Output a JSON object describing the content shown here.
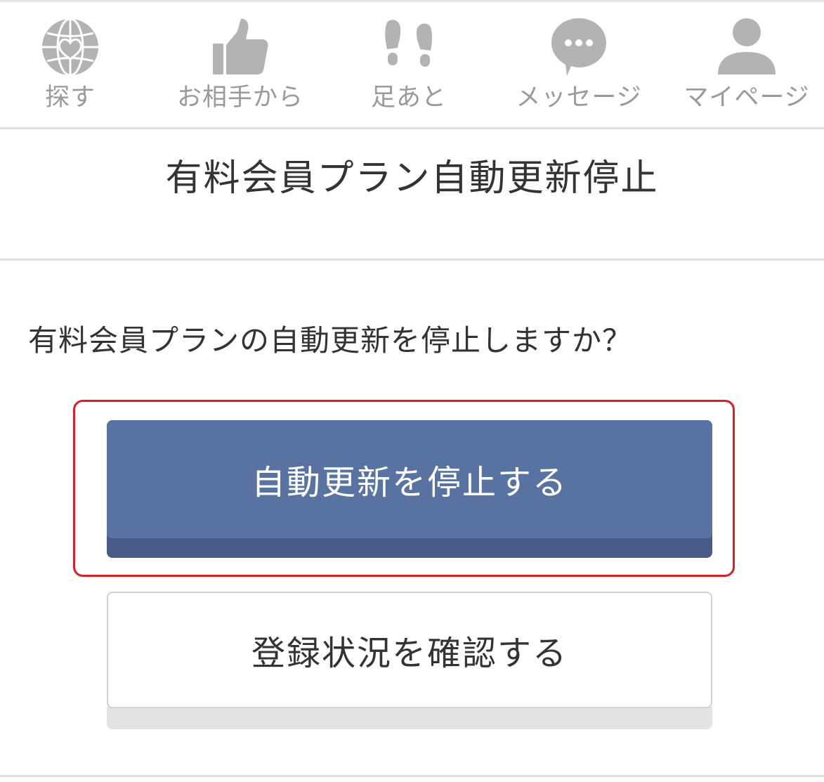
{
  "nav": {
    "items": [
      {
        "label": "探す",
        "icon": "globe-heart-icon"
      },
      {
        "label": "お相手から",
        "icon": "thumbs-up-icon"
      },
      {
        "label": "足あと",
        "icon": "footprints-icon"
      },
      {
        "label": "メッセージ",
        "icon": "chat-bubble-icon"
      },
      {
        "label": "マイページ",
        "icon": "person-icon"
      }
    ],
    "icon_color": "#b3b3b3",
    "label_color": "#9a9a9a"
  },
  "page": {
    "title": "有料会員プラン自動更新停止",
    "question": "有料会員プランの自動更新を停止しますか？"
  },
  "actions": {
    "stop_label": "自動更新を停止する",
    "check_label": "登録状況を確認する"
  },
  "colors": {
    "primary_button": "#5872a2",
    "primary_button_shadow": "#475b86",
    "highlight_border": "#d51f2c"
  }
}
